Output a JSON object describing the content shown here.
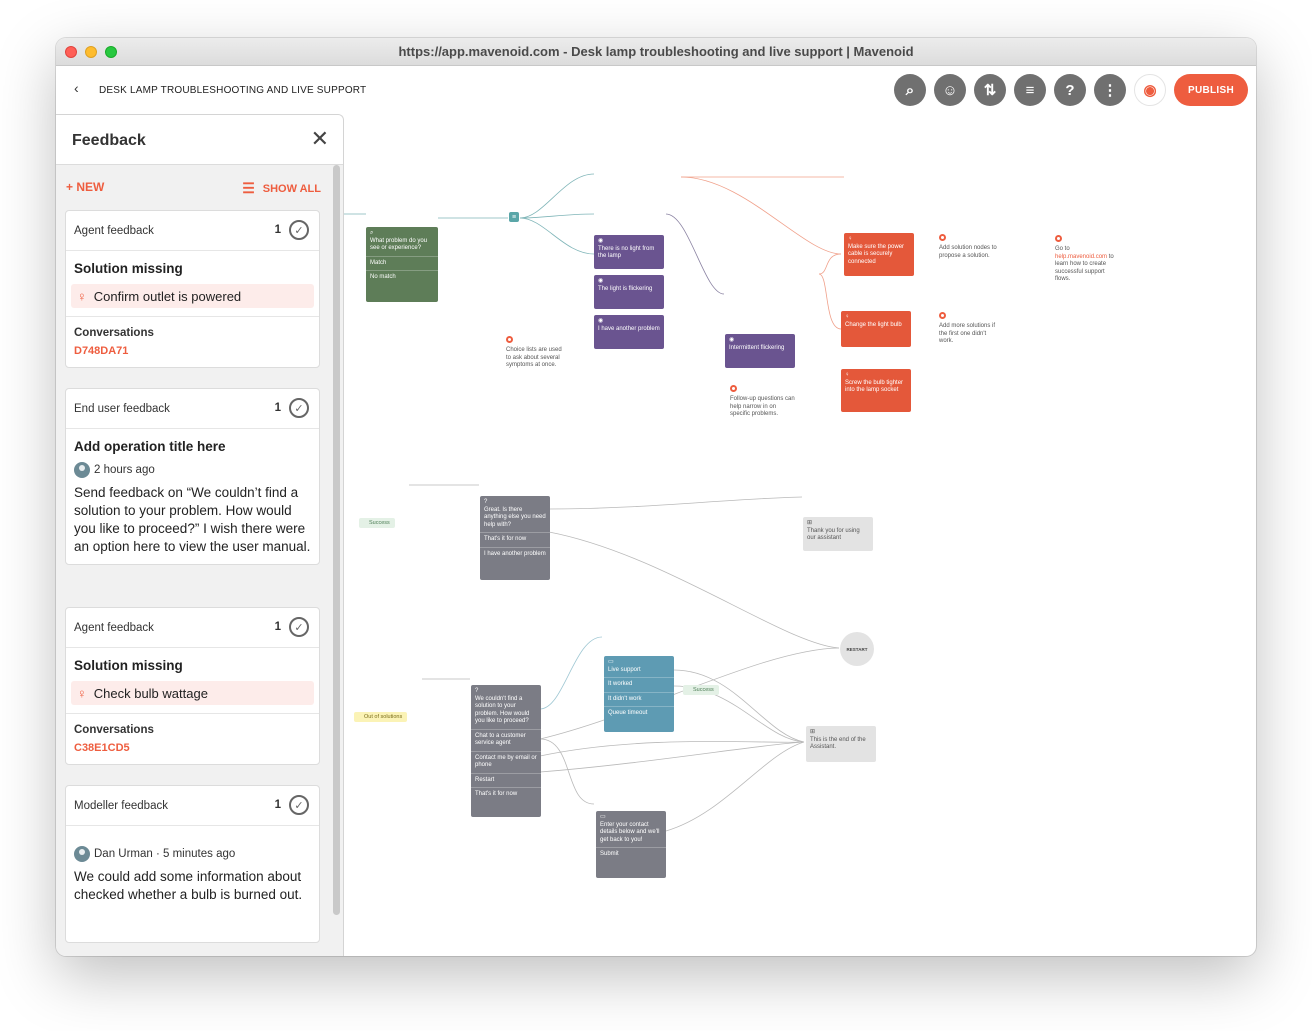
{
  "window": {
    "title": "https://app.mavenoid.com - Desk lamp troubleshooting and live support | Mavenoid"
  },
  "header": {
    "back_icon": "chevron-left-icon",
    "breadcrumb": "DESK LAMP TROUBLESHOOTING AND LIVE SUPPORT",
    "tools": [
      "search-icon",
      "agent-icon",
      "sort-icon",
      "sliders-icon",
      "help-icon",
      "more-icon",
      "eye-icon"
    ],
    "publish_label": "PUBLISH",
    "accent_color": "#ee5d3f"
  },
  "panel": {
    "title": "Feedback",
    "new_label": "+ NEW",
    "show_all_label": "SHOW ALL",
    "cards": [
      {
        "type": "Agent feedback",
        "count": "1",
        "title": "Solution missing",
        "solution": "Confirm outlet is powered",
        "conversations_label": "Conversations",
        "conversation_id": "D748DA71"
      },
      {
        "type": "End user feedback",
        "count": "1",
        "title": "Add operation title here",
        "meta": "2 hours ago",
        "message": "Send feedback on “We couldn’t find a solution to your problem. How would you like to proceed?” I wish there were an option here to view the user manual."
      },
      {
        "type": "Agent feedback",
        "count": "1",
        "title": "Solution missing",
        "solution": "Check bulb wattage",
        "conversations_label": "Conversations",
        "conversation_id": "C38E1CD5"
      },
      {
        "type": "Modeller feedback",
        "count": "1",
        "meta": "Dan Urman · 5 minutes ago",
        "message": "We could add some information about checked whether a bulb is burned out."
      }
    ]
  },
  "flow": {
    "q1": {
      "text": "What problem do you see or experience?",
      "rows": [
        "Match",
        "No match"
      ]
    },
    "sym1": "There is no light from the lamp",
    "sym2": "The light is flickering",
    "sym3": "I have another problem",
    "sym4": "Intermittent flickering",
    "sol1": "Make sure the power cable is securely connected",
    "sol2": "Change the light bulb",
    "sol3": "Screw the bulb tighter into the lamp socket",
    "note1": "Choice lists are used to ask about several symptoms at once.",
    "note2": "Follow-up questions can help narrow in on specific problems.",
    "note3": "Add solution nodes to propose a solution.",
    "note4": "Add more solutions if the first one didn't work.",
    "note5_pre": "Go to",
    "note5_link": "help.mavenoid.com",
    "note5_post": "to learn how to create successful support flows.",
    "success_chip": "Success",
    "q2": {
      "text": "Great. Is there anything else you need help with?",
      "rows": [
        "That's it for now",
        "I have another problem"
      ]
    },
    "end1": "Thank you for using our assistant",
    "restart": "RESTART",
    "oos_chip": "Out of solutions",
    "q3": {
      "text": "We couldn't find a solution to your problem. How would you like to proceed?",
      "rows": [
        "Chat to a customer service agent",
        "Contact me by email or phone",
        "Restart",
        "That's it for now"
      ]
    },
    "live": {
      "text": "Live support",
      "rows": [
        "It worked",
        "It didn't work",
        "Queue timeout"
      ]
    },
    "success_chip2": "Success",
    "end2": "This is the end of the Assistant.",
    "contact": {
      "text": "Enter your contact details below and we'll get back to you!",
      "rows": [
        "Submit"
      ]
    }
  }
}
